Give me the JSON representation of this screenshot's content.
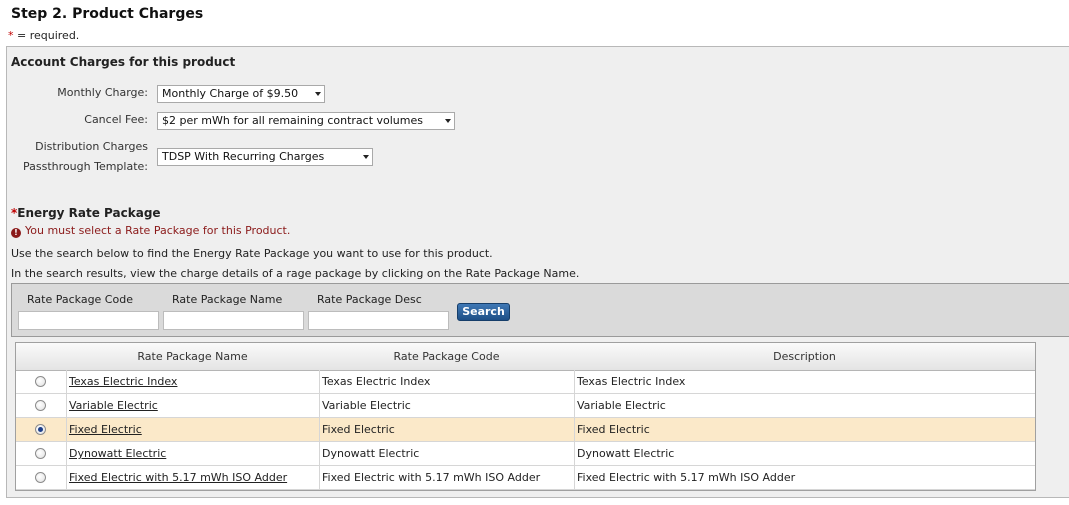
{
  "page": {
    "title": "Step 2. Product Charges",
    "required_star": "*",
    "required_text": " = required."
  },
  "account_charges": {
    "heading": "Account Charges for this product",
    "monthly_charge": {
      "label": "Monthly Charge:",
      "value": "Monthly Charge of $9.50"
    },
    "cancel_fee": {
      "label": "Cancel Fee:",
      "value": "$2 per mWh for all remaining contract volumes"
    },
    "distribution": {
      "label_line1": "Distribution Charges",
      "label_line2": "Passthrough Template:",
      "value": "TDSP With Recurring Charges"
    }
  },
  "energy_rate": {
    "star": "*",
    "heading": "Energy Rate Package",
    "error_icon": "!",
    "error": "You must select a Rate Package for this Product.",
    "info1": "Use the search below to find the Energy Rate Package you want to use for this product.",
    "info2": "In the search results, view the charge details of a rage package by clicking on the Rate Package Name."
  },
  "search": {
    "code_label": "Rate Package Code",
    "name_label": "Rate Package Name",
    "desc_label": "Rate Package Desc",
    "code_value": "",
    "name_value": "",
    "desc_value": "",
    "button": "Search"
  },
  "results": {
    "columns": [
      "Rate Package Name",
      "Rate Package Code",
      "Description"
    ],
    "selected_index": 2,
    "rows": [
      {
        "name": "Texas Electric Index",
        "code": "Texas Electric Index",
        "desc": "Texas Electric Index"
      },
      {
        "name": "Variable Electric",
        "code": "Variable Electric",
        "desc": "Variable Electric"
      },
      {
        "name": "Fixed Electric",
        "code": "Fixed Electric",
        "desc": "Fixed Electric"
      },
      {
        "name": "Dynowatt Electric",
        "code": "Dynowatt Electric",
        "desc": "Dynowatt Electric"
      },
      {
        "name": "Fixed Electric with 5.17 mWh ISO Adder",
        "code": "Fixed Electric with 5.17 mWh ISO Adder",
        "desc": "Fixed Electric with 5.17 mWh ISO Adder"
      }
    ]
  },
  "colors": {
    "selected_row": "#fbe9c9",
    "error": "#8b1a1a",
    "button": "#2a5f9c"
  }
}
